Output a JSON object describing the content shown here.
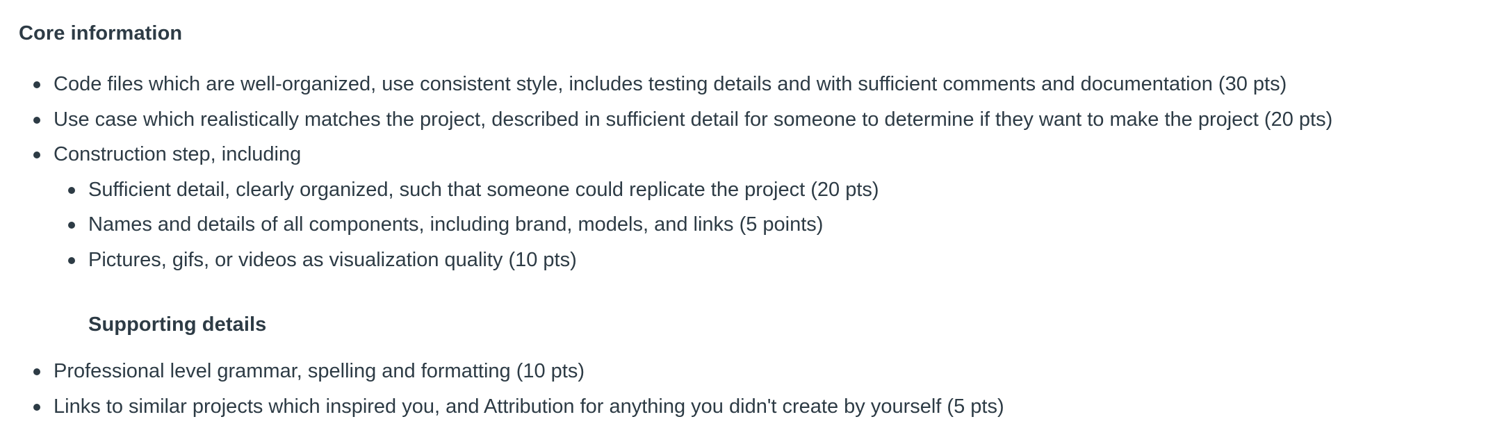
{
  "core": {
    "heading": "Core information",
    "items": [
      "Code files which are well-organized, use consistent style, includes testing details and with sufficient comments and documentation (30 pts)",
      "Use case which realistically matches the project, described in sufficient detail for someone to determine if they want to make the project (20 pts)",
      "Construction step, including"
    ],
    "sub_items": [
      "Sufficient detail, clearly organized, such that someone could replicate the project (20 pts)",
      "Names and details of all components, including brand, models, and links (5 points)",
      "Pictures, gifs, or videos as visualization quality (10 pts)"
    ]
  },
  "supporting": {
    "heading": "Supporting details",
    "items": [
      "Professional level grammar, spelling and formatting (10 pts)",
      "Links to similar projects which inspired you, and Attribution for anything you didn't create by  yourself (5 pts)"
    ]
  }
}
